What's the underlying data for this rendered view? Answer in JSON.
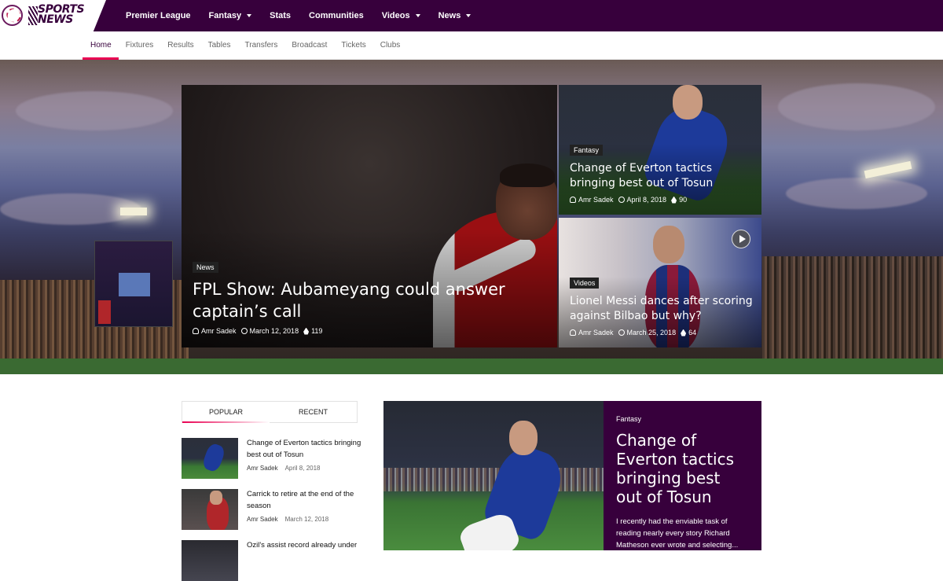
{
  "brand": {
    "logo_line1": "SPORTS",
    "logo_line2": "NEWS"
  },
  "main_nav": [
    {
      "label": "Premier League",
      "dropdown": false
    },
    {
      "label": "Fantasy",
      "dropdown": true
    },
    {
      "label": "Stats",
      "dropdown": false
    },
    {
      "label": "Communities",
      "dropdown": false
    },
    {
      "label": "Videos",
      "dropdown": true
    },
    {
      "label": "News",
      "dropdown": true
    }
  ],
  "sub_nav": [
    "Home",
    "Fixtures",
    "Results",
    "Tables",
    "Transfers",
    "Broadcast",
    "Tickets",
    "Clubs"
  ],
  "hero": {
    "main": {
      "tag": "News",
      "title": "FPL Show: Aubameyang could answer captain’s call",
      "author": "Amr Sadek",
      "date": "March 12, 2018",
      "count": "119"
    },
    "side1": {
      "tag": "Fantasy",
      "title": "Change of Everton tactics bringing best out of Tosun",
      "author": "Amr Sadek",
      "date": "April 8, 2018",
      "count": "90"
    },
    "side2": {
      "tag": "Videos",
      "title": "Lionel Messi dances after scoring against Bilbao but why?",
      "author": "Amr Sadek",
      "date": "March 25, 2018",
      "count": "64"
    }
  },
  "sidebar": {
    "tabs": [
      "POPULAR",
      "RECENT"
    ],
    "items": [
      {
        "title": "Change of Everton tactics bringing best out of Tosun",
        "author": "Amr Sadek",
        "date": "April 8, 2018"
      },
      {
        "title": "Carrick to retire at the end of the season",
        "author": "Amr Sadek",
        "date": "March 12, 2018"
      },
      {
        "title": "Ozil's assist record already under",
        "author": "",
        "date": ""
      }
    ]
  },
  "featured": {
    "category": "Fantasy",
    "title": "Change of Everton tactics bringing best out of Tosun",
    "excerpt": "I recently had the enviable task of reading nearly every story Richard Matheson ever wrote and selecting..."
  },
  "colors": {
    "brand": "#37003c",
    "accent": "#e90052"
  }
}
